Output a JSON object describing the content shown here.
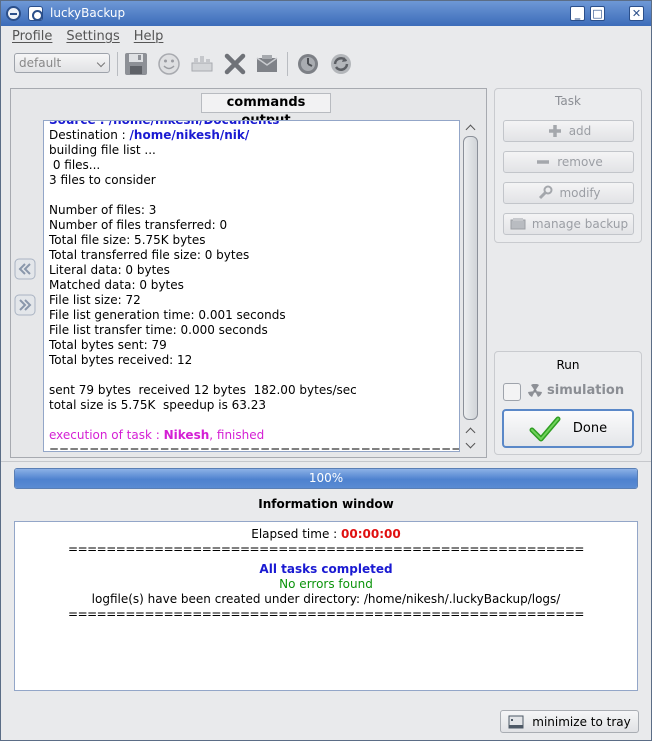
{
  "window": {
    "title": "luckyBackup",
    "controls": [
      "_",
      "□",
      "✕"
    ]
  },
  "menu": [
    "Profile",
    "Settings",
    "Help"
  ],
  "toolbar": {
    "profile_value": "default",
    "icons": [
      "save-icon",
      "smiley-icon",
      "schedule-icon",
      "delete-icon",
      "email-icon",
      "timer-icon",
      "refresh-icon"
    ]
  },
  "commands": {
    "title": "commands output",
    "lines": [
      {
        "t": "Source : /home/nikesh/Documents",
        "cls": "blue"
      },
      {
        "parts": [
          {
            "t": "Destination : "
          },
          {
            "t": "/home/nikesh/nik/",
            "cls": "blue"
          }
        ]
      },
      {
        "t": "building file list ..."
      },
      {
        "t": " 0 files..."
      },
      {
        "t": "3 files to consider"
      },
      {
        "t": ""
      },
      {
        "t": "Number of files: 3"
      },
      {
        "t": "Number of files transferred: 0"
      },
      {
        "t": "Total file size: 5.75K bytes"
      },
      {
        "t": "Total transferred file size: 0 bytes"
      },
      {
        "t": "Literal data: 0 bytes"
      },
      {
        "t": "Matched data: 0 bytes"
      },
      {
        "t": "File list size: 72"
      },
      {
        "t": "File list generation time: 0.001 seconds"
      },
      {
        "t": "File list transfer time: 0.000 seconds"
      },
      {
        "t": "Total bytes sent: 79"
      },
      {
        "t": "Total bytes received: 12"
      },
      {
        "t": ""
      },
      {
        "t": "sent 79 bytes  received 12 bytes  182.00 bytes/sec"
      },
      {
        "t": "total size is 5.75K  speedup is 63.23"
      },
      {
        "t": ""
      },
      {
        "parts": [
          {
            "t": "execution of task : ",
            "cls": "magenta"
          },
          {
            "t": "Nikesh",
            "cls": "mag-b"
          },
          {
            "t": ", finished",
            "cls": "magenta"
          }
        ]
      },
      {
        "t": "======================================================"
      }
    ]
  },
  "task": {
    "title": "Task",
    "add": "add",
    "remove": "remove",
    "modify": "modify",
    "manage": "manage backup"
  },
  "run": {
    "title": "Run",
    "simulation": "simulation",
    "done": "Done"
  },
  "progress": {
    "value": 100,
    "label": "100%"
  },
  "info": {
    "title": "Information window",
    "elapsed_label": "Elapsed time : ",
    "elapsed_value": "00:00:00",
    "separator": "======================================================",
    "tasks_completed": "All tasks completed",
    "no_errors": "No errors found",
    "logfile": "logfile(s) have been created under directory: /home/nikesh/.luckyBackup/logs/"
  },
  "tray": {
    "label": "minimize to tray"
  },
  "colors": {
    "accent": "#3c6cb9",
    "blue_text": "#1a1ad2",
    "magenta_text": "#d41fd4",
    "green_text": "#0b930b",
    "red_text": "#e01010"
  }
}
